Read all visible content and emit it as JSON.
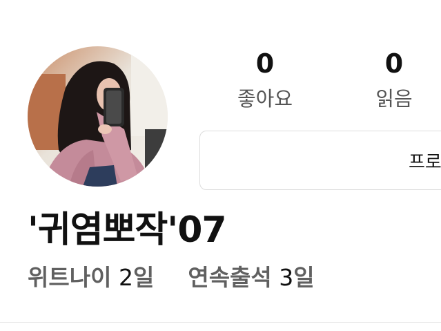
{
  "profile": {
    "avatar_icon": "profile-photo",
    "username": "'귀염뽀작'07"
  },
  "stats": {
    "likes": {
      "value": "0",
      "label": "좋아요"
    },
    "reads": {
      "value": "0",
      "label": "읽음"
    }
  },
  "profile_button": {
    "label": "프로"
  },
  "info": {
    "wit_age_label": "위트나이",
    "wit_age_value": "2",
    "wit_age_unit": "일",
    "streak_label": "연속출석",
    "streak_value": "3",
    "streak_unit": "일"
  },
  "colors": {
    "text": "#111111",
    "muted": "#606060",
    "border": "#dcdcdc"
  }
}
